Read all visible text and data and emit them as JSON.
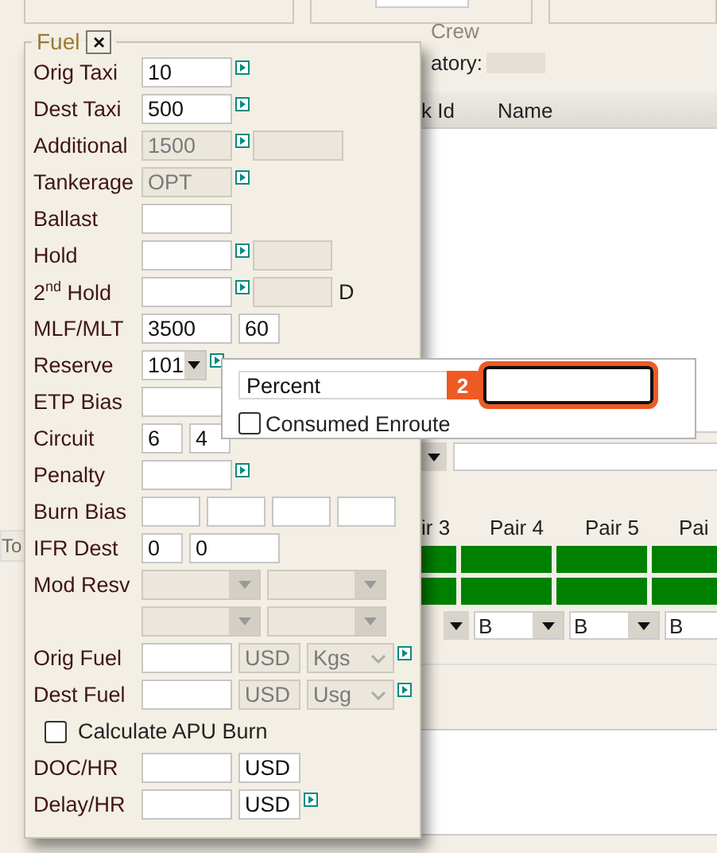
{
  "background": {
    "crew_title": "Crew",
    "crew_label": "atory:",
    "table": {
      "columns": [
        "k Id",
        "Name"
      ]
    },
    "pairs": {
      "headers": [
        "ir 3",
        "Pair 4",
        "Pair 5",
        "Pai"
      ],
      "selects": [
        "B",
        "B",
        "B"
      ]
    },
    "left_button": "To"
  },
  "fuel_panel": {
    "title": "Fuel",
    "close": "×",
    "rows": [
      {
        "kind": "fields",
        "label": "Orig Taxi",
        "fields": [
          {
            "kind": "text",
            "value": "10",
            "disabled": false
          },
          {
            "kind": "arrow"
          }
        ]
      },
      {
        "kind": "fields",
        "label": "Dest Taxi",
        "fields": [
          {
            "kind": "text",
            "value": "500",
            "disabled": false
          },
          {
            "kind": "arrow"
          }
        ]
      },
      {
        "kind": "fields",
        "label": "Additional",
        "fields": [
          {
            "kind": "text",
            "value": "1500",
            "disabled": true
          },
          {
            "kind": "arrow"
          },
          {
            "kind": "text",
            "disabled": true
          }
        ]
      },
      {
        "kind": "fields",
        "label": "Tankerage",
        "fields": [
          {
            "kind": "text",
            "value": "OPT",
            "disabled": true
          },
          {
            "kind": "arrow"
          }
        ]
      },
      {
        "kind": "fields",
        "label": "Ballast",
        "fields": [
          {
            "kind": "text",
            "disabled": false
          }
        ]
      },
      {
        "kind": "fields",
        "label": "Hold",
        "fields": [
          {
            "kind": "text",
            "disabled": false
          },
          {
            "kind": "arrow"
          },
          {
            "kind": "mid",
            "disabled": true
          }
        ]
      },
      {
        "kind": "fields",
        "label": "2$^{nd}$ Hold",
        "fields": [
          {
            "kind": "text",
            "disabled": false
          },
          {
            "kind": "arrow"
          },
          {
            "kind": "mid",
            "disabled": true
          },
          {
            "kind": "suffix",
            "value": "D"
          }
        ]
      },
      {
        "kind": "fields",
        "label": "MLF/MLT",
        "fields": [
          {
            "kind": "text",
            "value": "3500",
            "disabled": false
          },
          {
            "kind": "short",
            "value": "60",
            "disabled": false
          }
        ]
      },
      {
        "kind": "fields",
        "label": "Reserve",
        "fields": [
          {
            "kind": "combo",
            "value": "101",
            "disabled": false
          },
          {
            "kind": "arrow"
          }
        ]
      },
      {
        "kind": "fields",
        "label": "ETP Bias",
        "fields": [
          {
            "kind": "text",
            "disabled": false
          }
        ]
      },
      {
        "kind": "fields",
        "label": "Circuit",
        "fields": [
          {
            "kind": "short",
            "value": "6",
            "disabled": false
          },
          {
            "kind": "short",
            "value": "4",
            "disabled": false
          }
        ]
      },
      {
        "kind": "fields",
        "label": "Penalty",
        "fields": [
          {
            "kind": "text",
            "disabled": false
          },
          {
            "kind": "arrow"
          }
        ]
      },
      {
        "kind": "fields",
        "label": "Burn Bias",
        "fields": [
          {
            "kind": "tiny",
            "disabled": false
          },
          {
            "kind": "tiny",
            "disabled": false
          },
          {
            "kind": "tiny",
            "disabled": false
          },
          {
            "kind": "tiny",
            "disabled": false
          }
        ]
      },
      {
        "kind": "fields",
        "label": "IFR Dest",
        "fields": [
          {
            "kind": "short",
            "value": "0",
            "disabled": false
          },
          {
            "kind": "text",
            "value": "0",
            "disabled": false
          }
        ]
      },
      {
        "kind": "fields",
        "label": "Mod Resv",
        "fields": [
          {
            "kind": "select",
            "disabled": true
          },
          {
            "kind": "select",
            "disabled": true
          }
        ]
      },
      {
        "kind": "fields",
        "fields": [
          {
            "kind": "select",
            "disabled": true
          },
          {
            "kind": "select",
            "disabled": true
          }
        ]
      },
      {
        "kind": "fields",
        "label": "Orig Fuel",
        "fields": [
          {
            "kind": "text",
            "disabled": false
          },
          {
            "kind": "unit",
            "value": "USD",
            "disabled": true
          },
          {
            "kind": "unitselect",
            "value": "Kgs",
            "disabled": true
          },
          {
            "kind": "arrow"
          }
        ]
      },
      {
        "kind": "fields",
        "label": "Dest Fuel",
        "fields": [
          {
            "kind": "text",
            "disabled": false
          },
          {
            "kind": "unit",
            "value": "USD",
            "disabled": true
          },
          {
            "kind": "unitselect",
            "value": "Usg",
            "disabled": true
          },
          {
            "kind": "arrow"
          }
        ]
      },
      {
        "kind": "checkbox",
        "label": "Calculate APU Burn",
        "checked": false
      },
      {
        "kind": "fields",
        "label": "DOC/HR",
        "fields": [
          {
            "kind": "text",
            "disabled": false
          },
          {
            "kind": "unit",
            "value": "USD",
            "disabled": false
          }
        ]
      },
      {
        "kind": "fields",
        "label": "Delay/HR",
        "fields": [
          {
            "kind": "text",
            "disabled": false
          },
          {
            "kind": "unit",
            "value": "USD",
            "disabled": false
          },
          {
            "kind": "arrow"
          }
        ]
      }
    ]
  },
  "popup": {
    "label": "Percent",
    "badge": "2",
    "field": {
      "focused": true
    },
    "checkbox": {
      "label": "Consumed Enroute",
      "checked": false
    }
  }
}
